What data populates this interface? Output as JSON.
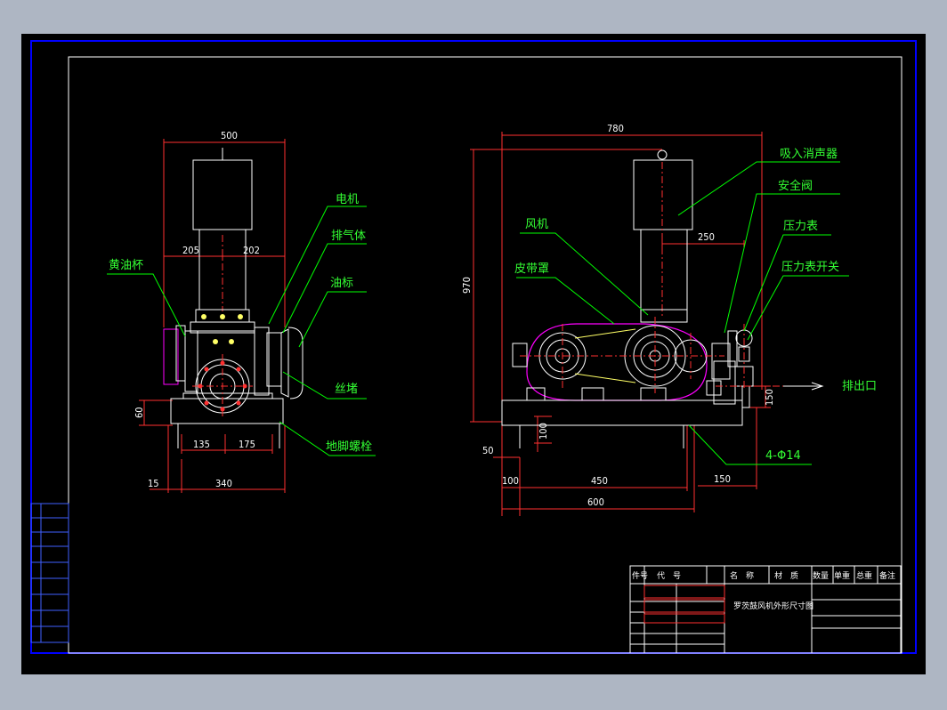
{
  "colors": {
    "background": "#000000",
    "frame_border": "#0000ff",
    "outline": "#ffffff",
    "leader": "#00ff00",
    "dimension": "#ff3030",
    "centerline": "#ff3030",
    "belt_guard": "#ff00ff",
    "pump_body": "#ffff66",
    "window_gray": "#aeb6c3"
  },
  "dimensions": {
    "top_width_left": "500",
    "left_half": "205",
    "right_half": "202",
    "base_height": "60",
    "base_left": "135",
    "base_right": "175",
    "edge_offset": "15",
    "base_span": "340",
    "overall_length": "780",
    "silencer_offset": "250",
    "overall_height": "970",
    "anchor_depth": "100",
    "outlet_height": "150",
    "foot_offset": "50",
    "foot_gap": "100",
    "hole_spacing": "450",
    "base_length": "600",
    "outlet_extension": "150",
    "anchor_holes": "4-Φ14"
  },
  "labels": {
    "motor": "电机",
    "exhaust_body": "排气体",
    "oil_gauge": "油标",
    "grease_cup": "黄油杯",
    "plug": "丝堵",
    "anchor_bolt": "地脚螺栓",
    "inlet_silencer": "吸入消声器",
    "safety_valve": "安全阀",
    "pressure_gauge": "压力表",
    "gauge_switch": "压力表开关",
    "blower": "风机",
    "belt_guard": "皮带罩",
    "outlet": "排出口"
  },
  "title_block": {
    "headers": [
      "件号",
      "代　号",
      "名　称",
      "材　质",
      "数量",
      "单重",
      "总重",
      "备注"
    ],
    "drawing_title": "罗茨鼓风机外形尺寸图"
  }
}
